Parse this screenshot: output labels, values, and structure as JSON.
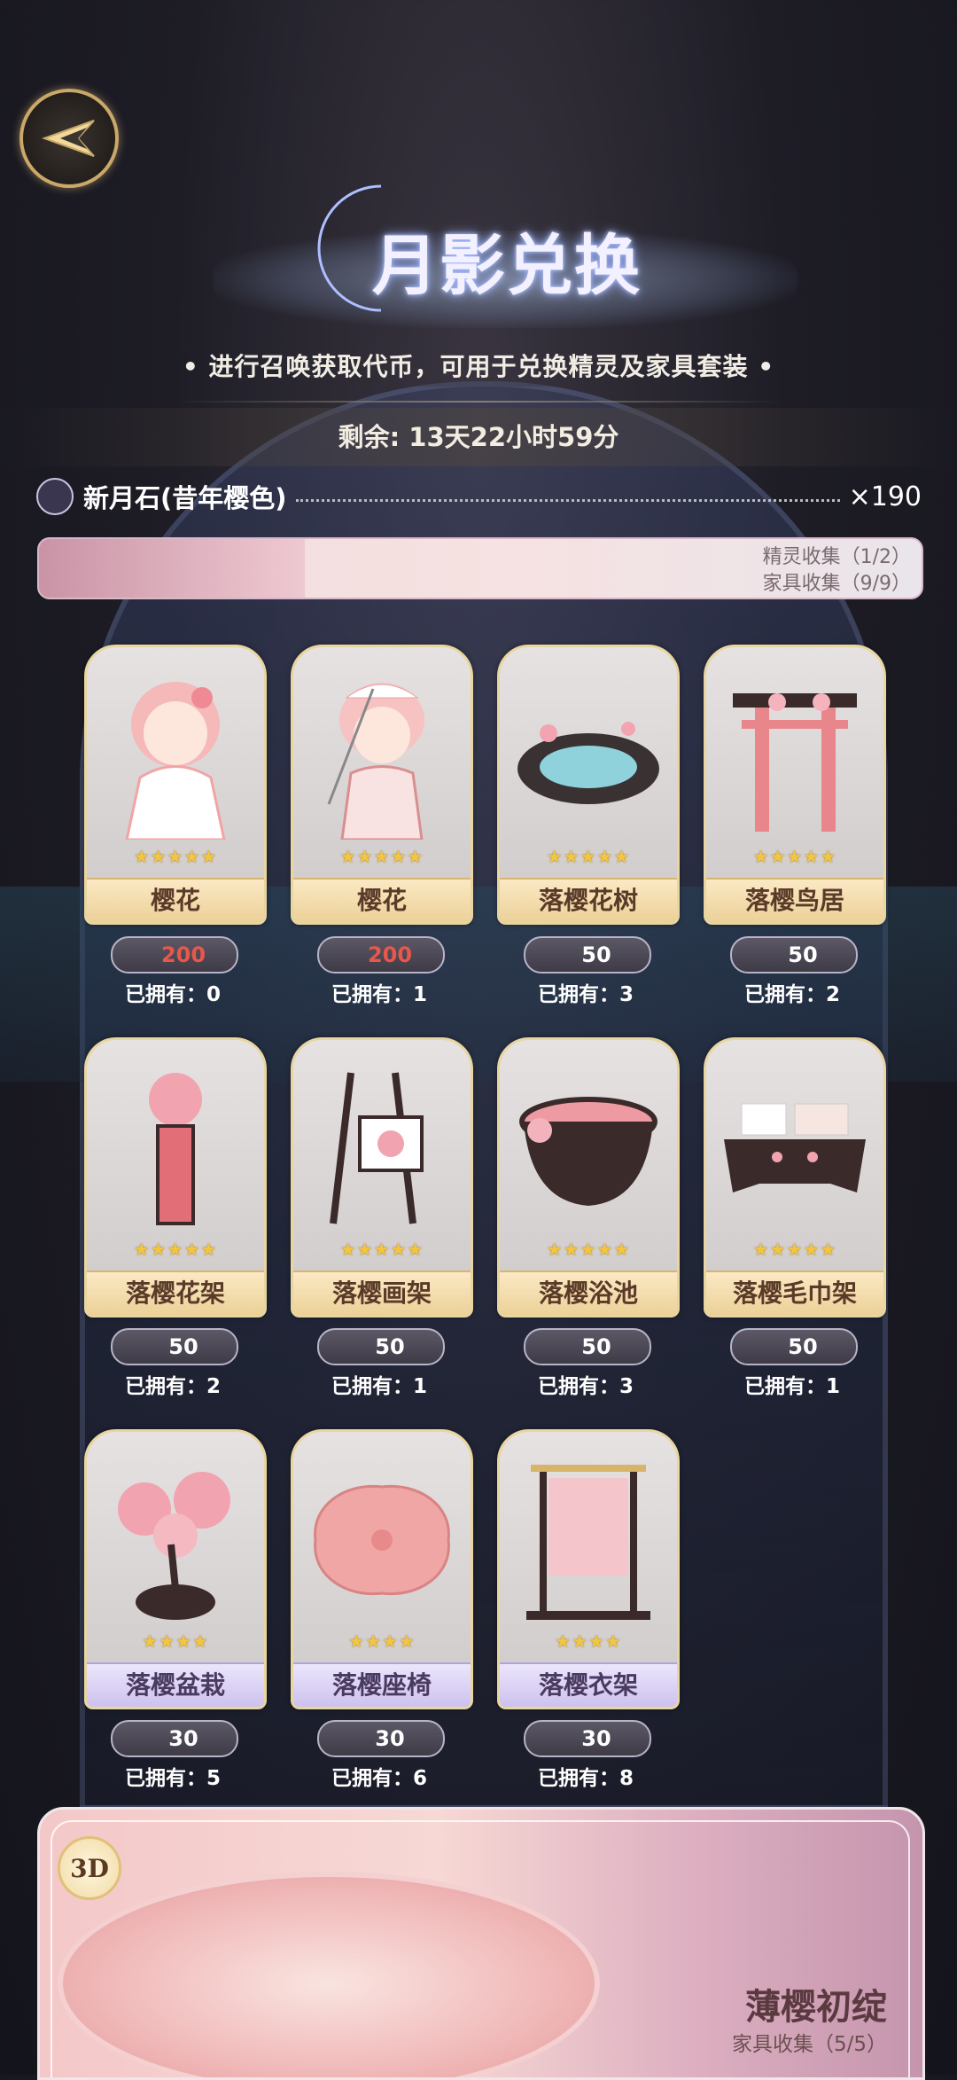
{
  "header": {
    "title": "月影兑换",
    "subtitle": "• 进行召唤获取代币，可用于兑换精灵及家具套装 •",
    "remaining": "剩余: 13天22小时59分"
  },
  "currency": {
    "name": "新月石(昔年樱色)",
    "count": "×190"
  },
  "banner_top": {
    "line1": "精灵收集（1/2）",
    "line2": "家具收集（9/9）"
  },
  "items": [
    {
      "name": "樱花",
      "stars": "★★★★★",
      "price": "200",
      "owned": "已拥有：0"
    },
    {
      "name": "樱花",
      "stars": "★★★★★",
      "price": "200",
      "owned": "已拥有：1"
    },
    {
      "name": "落樱花树",
      "stars": "★★★★★",
      "price": "50",
      "owned": "已拥有：3"
    },
    {
      "name": "落樱鸟居",
      "stars": "★★★★★",
      "price": "50",
      "owned": "已拥有：2"
    },
    {
      "name": "落樱花架",
      "stars": "★★★★★",
      "price": "50",
      "owned": "已拥有：2"
    },
    {
      "name": "落樱画架",
      "stars": "★★★★★",
      "price": "50",
      "owned": "已拥有：1"
    },
    {
      "name": "落樱浴池",
      "stars": "★★★★★",
      "price": "50",
      "owned": "已拥有：3"
    },
    {
      "name": "落樱毛巾架",
      "stars": "★★★★★",
      "price": "50",
      "owned": "已拥有：1"
    },
    {
      "name": "落樱盆栽",
      "stars": "★★★★",
      "price": "30",
      "owned": "已拥有：5"
    },
    {
      "name": "落樱座椅",
      "stars": "★★★★",
      "price": "30",
      "owned": "已拥有：6"
    },
    {
      "name": "落樱衣架",
      "stars": "★★★★",
      "price": "30",
      "owned": "已拥有：8"
    }
  ],
  "bottom_banner": {
    "badge": "3D",
    "set_name": "薄樱初绽",
    "collection": "家具收集（5/5）"
  }
}
